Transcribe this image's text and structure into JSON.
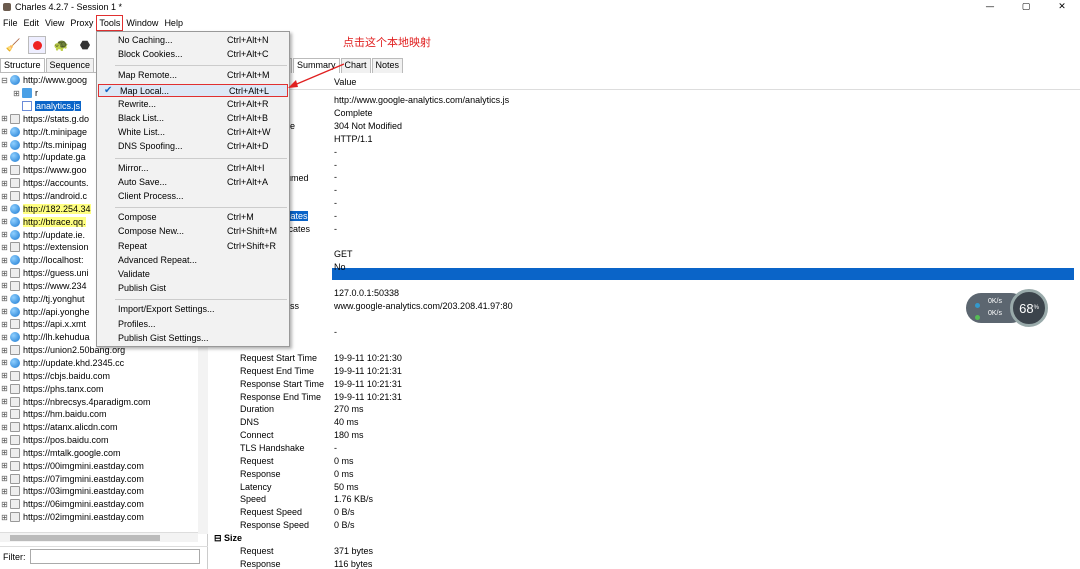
{
  "window": {
    "title": "Charles 4.2.7 - Session 1 *",
    "controls": [
      "—",
      "▢",
      "✕"
    ]
  },
  "menubar": {
    "items": [
      "File",
      "Edit",
      "View",
      "Proxy",
      "Tools",
      "Window",
      "Help"
    ],
    "active": "Tools"
  },
  "annotation": "点击这个本地映射",
  "left": {
    "tabs": [
      "Structure",
      "Sequence"
    ],
    "tree": [
      {
        "exp": "⊟",
        "icon": "globe",
        "text": "http://www.goog",
        "indent": 0
      },
      {
        "exp": "⊞",
        "icon": "folder",
        "text": "r",
        "indent": 1
      },
      {
        "exp": "",
        "icon": "file",
        "text": "analytics.js",
        "indent": 1,
        "selected": true
      },
      {
        "exp": "⊞",
        "icon": "lock",
        "text": "https://stats.g.do",
        "indent": 0
      },
      {
        "exp": "⊞",
        "icon": "globe",
        "text": "http://t.minipage",
        "indent": 0
      },
      {
        "exp": "⊞",
        "icon": "globe",
        "text": "http://ts.minipag",
        "indent": 0
      },
      {
        "exp": "⊞",
        "icon": "globe",
        "text": "http://update.ga",
        "indent": 0
      },
      {
        "exp": "⊞",
        "icon": "lock",
        "text": "https://www.goo",
        "indent": 0
      },
      {
        "exp": "⊞",
        "icon": "lock",
        "text": "https://accounts.",
        "indent": 0
      },
      {
        "exp": "⊞",
        "icon": "lock",
        "text": "https://android.c",
        "indent": 0
      },
      {
        "exp": "⊞",
        "icon": "globe",
        "text": "http://182.254.34",
        "indent": 0,
        "highlight": true
      },
      {
        "exp": "⊞",
        "icon": "globe",
        "text": "http://btrace.qq.",
        "indent": 0,
        "highlight": true
      },
      {
        "exp": "⊞",
        "icon": "globe",
        "text": "http://update.ie.",
        "indent": 0
      },
      {
        "exp": "⊞",
        "icon": "lock",
        "text": "https://extension",
        "indent": 0
      },
      {
        "exp": "⊞",
        "icon": "globe",
        "text": "http://localhost:",
        "indent": 0
      },
      {
        "exp": "⊞",
        "icon": "lock",
        "text": "https://guess.uni",
        "indent": 0
      },
      {
        "exp": "⊞",
        "icon": "lock",
        "text": "https://www.234",
        "indent": 0
      },
      {
        "exp": "⊞",
        "icon": "globe",
        "text": "http://tj.yonghut",
        "indent": 0
      },
      {
        "exp": "⊞",
        "icon": "globe",
        "text": "http://api.yonghe",
        "indent": 0
      },
      {
        "exp": "⊞",
        "icon": "lock",
        "text": "https://api.x.xmt",
        "indent": 0
      },
      {
        "exp": "⊞",
        "icon": "globe",
        "text": "http://lh.kehudua",
        "indent": 0
      },
      {
        "exp": "⊞",
        "icon": "lock",
        "text": "https://union2.50bang.org",
        "indent": 0
      },
      {
        "exp": "⊞",
        "icon": "globe",
        "text": "http://update.khd.2345.cc",
        "indent": 0
      },
      {
        "exp": "⊞",
        "icon": "lock",
        "text": "https://cbjs.baidu.com",
        "indent": 0
      },
      {
        "exp": "⊞",
        "icon": "lock",
        "text": "https://phs.tanx.com",
        "indent": 0
      },
      {
        "exp": "⊞",
        "icon": "lock",
        "text": "https://nbrecsys.4paradigm.com",
        "indent": 0
      },
      {
        "exp": "⊞",
        "icon": "lock",
        "text": "https://hm.baidu.com",
        "indent": 0
      },
      {
        "exp": "⊞",
        "icon": "lock",
        "text": "https://atanx.alicdn.com",
        "indent": 0
      },
      {
        "exp": "⊞",
        "icon": "lock",
        "text": "https://pos.baidu.com",
        "indent": 0
      },
      {
        "exp": "⊞",
        "icon": "lock",
        "text": "https://mtalk.google.com",
        "indent": 0
      },
      {
        "exp": "⊞",
        "icon": "lock",
        "text": "https://00imgmini.eastday.com",
        "indent": 0
      },
      {
        "exp": "⊞",
        "icon": "lock",
        "text": "https://07imgmini.eastday.com",
        "indent": 0
      },
      {
        "exp": "⊞",
        "icon": "lock",
        "text": "https://03imgmini.eastday.com",
        "indent": 0
      },
      {
        "exp": "⊞",
        "icon": "lock",
        "text": "https://06imgmini.eastday.com",
        "indent": 0
      },
      {
        "exp": "⊞",
        "icon": "lock",
        "text": "https://02imgmini.eastday.com",
        "indent": 0
      }
    ],
    "filter_label": "Filter:",
    "filter_value": ""
  },
  "right": {
    "tabs": [
      "nts",
      "Summary",
      "Chart",
      "Notes"
    ],
    "value_header": "Value",
    "values": [
      {
        "text": "http://www.google-analytics.com/analytics.js"
      },
      {
        "text": "Complete"
      },
      {
        "text": "304 Not Modified"
      },
      {
        "text": "HTTP/1.1"
      },
      {
        "text": "-"
      },
      {
        "text": "-"
      },
      {
        "text": "-"
      },
      {
        "text": "-"
      },
      {
        "text": "-"
      },
      {
        "text": "-"
      },
      {
        "text": "-"
      }
    ],
    "label_partials": [
      {
        "text": "e",
        "row": 3
      },
      {
        "text": "umed",
        "row": 7
      },
      {
        "text": "icates",
        "row": 10,
        "selected": true
      },
      {
        "text": "ficates",
        "row": 11
      },
      {
        "text": "ss",
        "row": 18
      }
    ],
    "method": "GET",
    "kept_alive": "No",
    "client_address": "127.0.0.1:50338",
    "remote_address": "www.google-analytics.com/203.208.41.97:80",
    "dash": "-",
    "timing": [
      {
        "label": "Request Start Time",
        "value": "19-9-11 10:21:30"
      },
      {
        "label": "Request End Time",
        "value": "19-9-11 10:21:31"
      },
      {
        "label": "Response Start Time",
        "value": "19-9-11 10:21:31"
      },
      {
        "label": "Response End Time",
        "value": "19-9-11 10:21:31"
      },
      {
        "label": "Duration",
        "value": "270 ms"
      },
      {
        "label": "DNS",
        "value": "40 ms"
      },
      {
        "label": "Connect",
        "value": "180 ms"
      },
      {
        "label": "TLS Handshake",
        "value": "-"
      },
      {
        "label": "Request",
        "value": "0 ms"
      },
      {
        "label": "Response",
        "value": "0 ms"
      },
      {
        "label": "Latency",
        "value": "50 ms"
      },
      {
        "label": "Speed",
        "value": "1.76 KB/s"
      },
      {
        "label": "Request Speed",
        "value": "0 B/s"
      },
      {
        "label": "Response Speed",
        "value": "0 B/s"
      }
    ],
    "size_header": "Size",
    "size": [
      {
        "label": "Request",
        "value": "371 bytes"
      },
      {
        "label": "Response",
        "value": "116 bytes"
      }
    ]
  },
  "tools_menu": {
    "groups": [
      [
        {
          "label": "No Caching...",
          "shortcut": "Ctrl+Alt+N"
        },
        {
          "label": "Block Cookies...",
          "shortcut": "Ctrl+Alt+C"
        }
      ],
      [
        {
          "label": "Map Remote...",
          "shortcut": "Ctrl+Alt+M"
        },
        {
          "label": "Map Local...",
          "shortcut": "Ctrl+Alt+L",
          "checked": true,
          "highlighted": true
        },
        {
          "label": "Rewrite...",
          "shortcut": "Ctrl+Alt+R"
        },
        {
          "label": "Black List...",
          "shortcut": "Ctrl+Alt+B"
        },
        {
          "label": "White List...",
          "shortcut": "Ctrl+Alt+W"
        },
        {
          "label": "DNS Spoofing...",
          "shortcut": "Ctrl+Alt+D"
        }
      ],
      [
        {
          "label": "Mirror...",
          "shortcut": "Ctrl+Alt+I"
        },
        {
          "label": "Auto Save...",
          "shortcut": "Ctrl+Alt+A"
        },
        {
          "label": "Client Process...",
          "shortcut": ""
        }
      ],
      [
        {
          "label": "Compose",
          "shortcut": "Ctrl+M"
        },
        {
          "label": "Compose New...",
          "shortcut": "Ctrl+Shift+M"
        },
        {
          "label": "Repeat",
          "shortcut": "Ctrl+Shift+R"
        },
        {
          "label": "Advanced Repeat...",
          "shortcut": ""
        },
        {
          "label": "Validate",
          "shortcut": ""
        },
        {
          "label": "Publish Gist",
          "shortcut": ""
        }
      ],
      [
        {
          "label": "Import/Export Settings...",
          "shortcut": ""
        },
        {
          "label": "Profiles...",
          "shortcut": ""
        },
        {
          "label": "Publish Gist Settings...",
          "shortcut": ""
        }
      ]
    ]
  },
  "widget": {
    "upload": "0K/s",
    "download": "0K/s",
    "percent": "68",
    "percent_unit": "%"
  },
  "colors": {
    "selection": "#0a64c8",
    "highlight": "#ffff80",
    "annotation": "#e02020"
  }
}
